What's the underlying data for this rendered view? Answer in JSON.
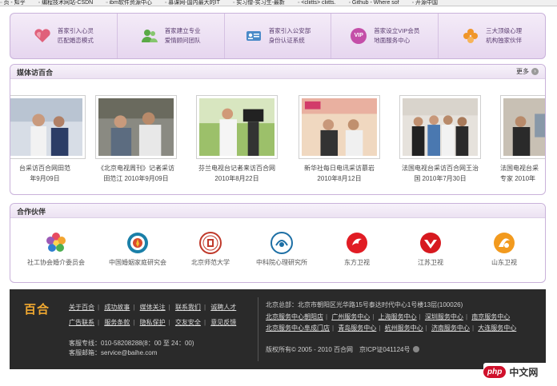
{
  "bookmarks": [
    "页 - 知乎",
    "编程技术网站-CSDN",
    "ibm软件资源中心",
    "慕课网-国内最大的IT",
    "实习僧-实习生-最新",
    "<cliitts> cliitts.",
    "Github - Where sof",
    "开源中国"
  ],
  "features": [
    {
      "line1": "首家引入心灵",
      "line2": "匹配婚恋模式",
      "icon": "heart-icon",
      "color": "#e0607a"
    },
    {
      "line1": "首家建立专业",
      "line2": "爱情顾问团队",
      "icon": "users-icon",
      "color": "#5aaa46"
    },
    {
      "line1": "首家引入公安部",
      "line2": "身份认证系统",
      "icon": "id-card-icon",
      "color": "#4a8ac8"
    },
    {
      "line1": "首家设立VIP会员",
      "line2": "地面服务中心",
      "icon": "vip-icon",
      "color": "#c44ea8",
      "icon_text": "VIP"
    },
    {
      "line1": "三大顶级心理",
      "line2": "机构独家伙伴",
      "icon": "clover-icon",
      "color": "#f0962a"
    }
  ],
  "media": {
    "title": "媒体访百合",
    "more": "更多",
    "items": [
      {
        "line1": "台采访百合网田范",
        "line2": "年9月09日"
      },
      {
        "line1": "《北京电视周刊》记者采访",
        "line2": "田范江 2010年9月09日"
      },
      {
        "line1": "芬兰电视台记者来访百合网",
        "line2": "2010年8月22日"
      },
      {
        "line1": "新华社每日电讯采访慕岩",
        "line2": "2010年8月12日"
      },
      {
        "line1": "法国电视台采访百合网王治",
        "line2": "国 2010年7月30日"
      },
      {
        "line1": "法国电视台采",
        "line2": "专家 2010年"
      }
    ]
  },
  "partners": {
    "title": "合作伙伴",
    "items": [
      {
        "label": "社工协会婚介委员会",
        "icon": "flower-logo-icon"
      },
      {
        "label": "中国婚姻家庭研究会",
        "icon": "seal-logo-icon"
      },
      {
        "label": "北京师范大学",
        "icon": "bnu-logo-icon"
      },
      {
        "label": "中科院心理研究所",
        "icon": "cas-logo-icon"
      },
      {
        "label": "东方卫视",
        "icon": "dragon-tv-icon"
      },
      {
        "label": "江苏卫视",
        "icon": "jstv-icon"
      },
      {
        "label": "山东卫视",
        "icon": "sdtv-icon"
      }
    ]
  },
  "footer": {
    "logo": "百合",
    "links_row1": [
      "关于百合",
      "成功故事",
      "媒体关注",
      "联系我们",
      "诚聘人才"
    ],
    "links_row2": [
      "广告联系",
      "服务条款",
      "隐私保护",
      "交友安全",
      "意见反馈"
    ],
    "phone": "客服专线：010-58208288(8：00 至 24：00)",
    "email": "客服邮箱：service@baihe.com",
    "address": "北京总部：北京市朝阳区光华路15号泰达时代中心1号楼13层(100026)",
    "branches_row1": [
      "北京服务中心朝阳店",
      "广州服务中心",
      "上海服务中心",
      "深圳服务中心",
      "南京服务中心"
    ],
    "branches_row2": [
      "北京服务中心阜成门店",
      "青岛服务中心",
      "杭州服务中心",
      "济南服务中心",
      "大连服务中心"
    ],
    "copyright": "版权所有© 2005 - 2010 百合网　京ICP证041124号"
  },
  "watermark": {
    "p1": "php",
    "p2": "中文网"
  }
}
